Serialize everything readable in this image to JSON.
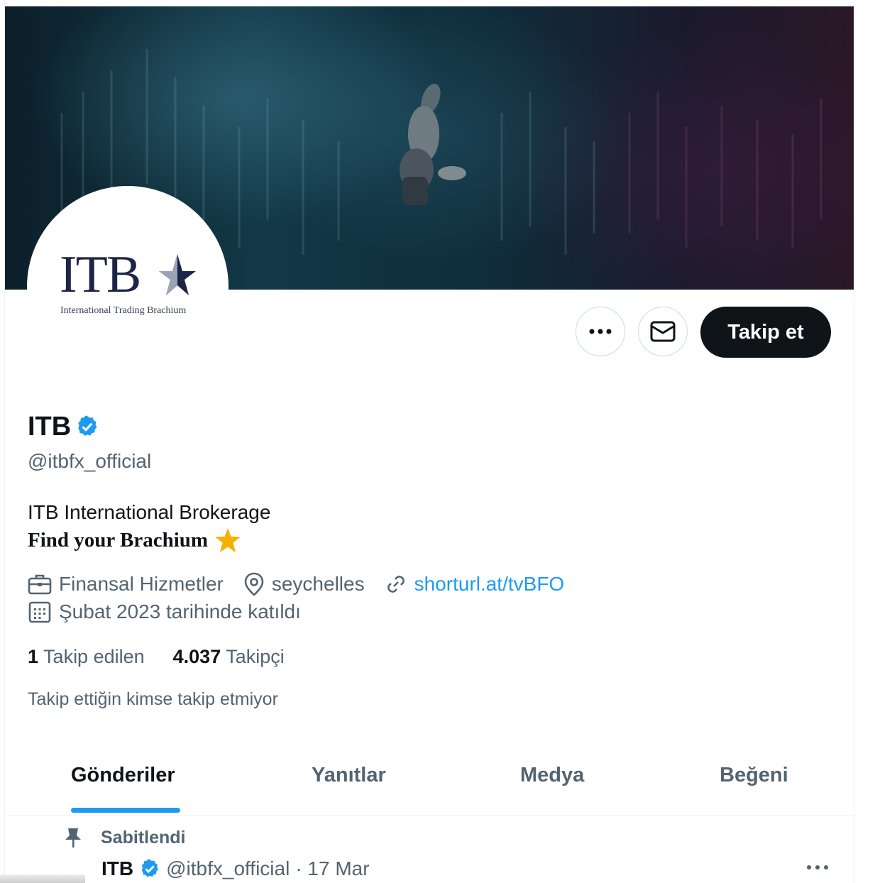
{
  "profile": {
    "logo_text": "ITB",
    "logo_subtitle": "International Trading Brachium",
    "name": "ITB",
    "handle": "@itbfx_official",
    "bio_line1": "ITB International Brokerage",
    "bio_line2": "Find your Brachium",
    "category": "Finansal Hizmetler",
    "location": "seychelles",
    "website": "shorturl.at/tvBFO",
    "joined": "Şubat 2023 tarihinde katıldı"
  },
  "actions": {
    "follow_label": "Takip et"
  },
  "stats": {
    "following_count": "1",
    "following_label": "Takip edilen",
    "followers_count": "4.037",
    "followers_label": "Takipçi",
    "followers_note": "Takip ettiğin kimse takip etmiyor"
  },
  "tabs": [
    {
      "label": "Gönderiler",
      "active": true
    },
    {
      "label": "Yanıtlar",
      "active": false
    },
    {
      "label": "Medya",
      "active": false
    },
    {
      "label": "Beğeni",
      "active": false
    }
  ],
  "pinned_post": {
    "pinned_label": "Sabitlendi",
    "author_name": "ITB",
    "author_handle": "@itbfx_official",
    "date": "· 17 Mar"
  },
  "icons": {
    "verified": "verified-badge-icon",
    "more": "more-dots-icon",
    "message": "envelope-icon",
    "category": "briefcase-icon",
    "location": "location-pin-icon",
    "website": "link-icon",
    "joined": "calendar-icon",
    "pinned": "pin-icon",
    "star": "star-emoji-icon"
  },
  "colors": {
    "accent": "#1d9bf0",
    "text_primary": "#0f1419",
    "text_secondary": "#536471",
    "follow_button_bg": "#0f1419",
    "star": "#f5b000",
    "logo_navy": "#1c2447"
  }
}
